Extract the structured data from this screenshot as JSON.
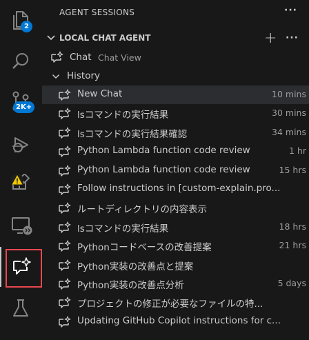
{
  "activity_bar": {
    "explorer_badge": "2",
    "source_control_badge": "2K+"
  },
  "panel": {
    "header": "AGENT SESSIONS",
    "section_title": "LOCAL CHAT AGENT",
    "chat_label": "Chat",
    "chat_description": "Chat View",
    "history_label": "History",
    "sessions": [
      {
        "title": "New Chat",
        "time": "10 mins"
      },
      {
        "title": "lsコマンドの実行結果",
        "time": "30 mins"
      },
      {
        "title": "lsコマンドの実行結果確認",
        "time": "34 mins"
      },
      {
        "title": "Python Lambda function code review",
        "time": "1 hr"
      },
      {
        "title": "Python Lambda function code review",
        "time": "15 hrs"
      },
      {
        "title": "Follow instructions in [custom-explain.pro...",
        "time": ""
      },
      {
        "title": "ルートディレクトリの内容表示",
        "time": ""
      },
      {
        "title": "lsコマンドの実行結果",
        "time": "18 hrs"
      },
      {
        "title": "Pythonコードベースの改善提案",
        "time": "21 hrs"
      },
      {
        "title": "Python実装の改善点と提案",
        "time": ""
      },
      {
        "title": "Python実装の改善点分析",
        "time": "5 days"
      },
      {
        "title": "プロジェクトの修正が必要なファイルの特...",
        "time": ""
      },
      {
        "title": "Updating GitHub Copilot instructions for c...",
        "time": ""
      }
    ]
  },
  "colors": {
    "badge": "#0078d4",
    "highlight_border": "#e9484f",
    "warning": "#f0c800"
  }
}
